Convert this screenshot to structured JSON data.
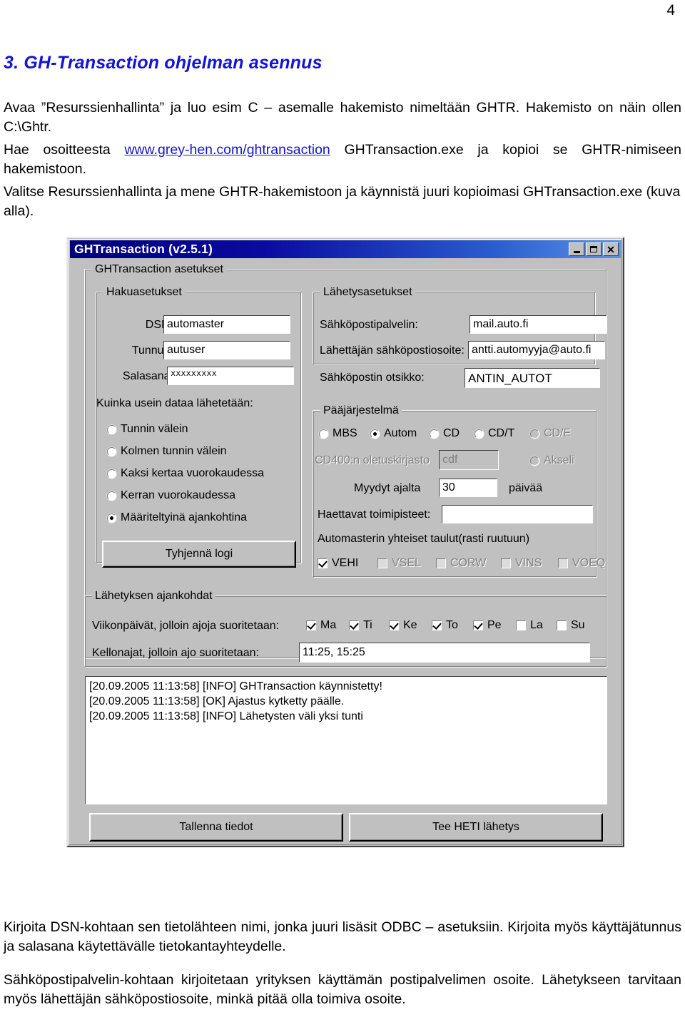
{
  "document": {
    "page_number": "4",
    "heading": "3. GH-Transaction ohjelman asennus",
    "para1_a": "Avaa ”Resurssienhallinta” ja luo esim C – asemalle hakemisto nimeltään GHTR. Hakemisto on näin ollen C:\\Ghtr.",
    "para2_pre": "Hae osoitteesta ",
    "para2_link": "www.grey-hen.com/ghtransaction",
    "para2_post": " GHTransaction.exe ja kopioi se GHTR-nimiseen hakemistoon.",
    "para3": "Valitse Resurssienhallinta ja mene GHTR-hakemistoon ja käynnistä juuri kopioimasi GHTransaction.exe (kuva alla).",
    "para4": "Kirjoita DSN-kohtaan sen tietolähteen nimi, jonka juuri lisäsit ODBC – asetuksiin. Kirjoita myös käyttäjätunnus ja salasana käytettävälle tietokantayhteydelle.",
    "para5": "Sähköpostipalvelin-kohtaan kirjoitetaan yrityksen käyttämän postipalvelimen osoite. Lähetykseen tarvitaan myös lähettäjän sähköpostiosoite, minkä pitää olla toimiva osoite.",
    "link_color": "#1414d2",
    "heading_color": "#1414d2"
  },
  "dialog": {
    "title": "GHTransaction (v2.5.1)",
    "titlebar_color": "#00007b",
    "face_color": "#c0c0c0",
    "titlebar_buttons": [
      {
        "name": "minimize-button",
        "glyph": "_"
      },
      {
        "name": "maximize-button",
        "glyph": "□"
      },
      {
        "name": "close-button",
        "glyph": "X"
      }
    ],
    "outer_group_label": "GHTransaction asetukset",
    "search_group": {
      "label": "Hakuasetukset",
      "dsn_label": "DSN:",
      "dsn_value": "automaster",
      "user_label": "Tunnus:",
      "user_value": "autuser",
      "password_label": "Salasana:",
      "password_value": "xxxxxxxxx"
    },
    "frequency": {
      "label": "Kuinka usein dataa lähetetään:",
      "options": [
        {
          "label": "Tunnin välein",
          "selected": false
        },
        {
          "label": "Kolmen tunnin välein",
          "selected": false
        },
        {
          "label": "Kaksi kertaa vuorokaudessa",
          "selected": false
        },
        {
          "label": "Kerran vuorokaudessa",
          "selected": false
        },
        {
          "label": "Määriteltyinä ajankohtina",
          "selected": true
        }
      ],
      "clear_log_button": "Tyhjennä logi"
    },
    "send_group": {
      "label": "Lähetysasetukset",
      "server_label": "Sähköpostipalvelin:",
      "server_value": "mail.auto.fi",
      "sender_label": "Lähettäjän sähköpostiosoite:",
      "sender_value": "antti.automyyja@auto.fi",
      "subject_label": "Sähköpostin otsikko:",
      "subject_value": "ANTIN_AUTOT"
    },
    "main_system": {
      "label": "Pääjärjestelmä",
      "options": [
        {
          "label": "MBS",
          "selected": false,
          "disabled": false
        },
        {
          "label": "Autom",
          "selected": true,
          "disabled": false
        },
        {
          "label": "CD",
          "selected": false,
          "disabled": false
        },
        {
          "label": "CD/T",
          "selected": false,
          "disabled": false
        },
        {
          "label": "CD/E",
          "selected": false,
          "disabled": true
        }
      ],
      "cd400_label": "CD400:n oletuskirjasto",
      "cd400_value": "cdf",
      "akseli_label": "Akseli",
      "akseli_selected": false,
      "sold_label": "Myydyt ajalta",
      "sold_value": "30",
      "sold_unit": "päivää",
      "offices_label": "Haettavat toimipisteet:",
      "offices_value": "",
      "tables_label": "Automasterin yhteiset taulut(rasti ruutuun)",
      "tables": [
        {
          "label": "VEHI",
          "checked": true,
          "disabled": false
        },
        {
          "label": "VSEL",
          "checked": false,
          "disabled": true
        },
        {
          "label": "CORW",
          "checked": false,
          "disabled": true
        },
        {
          "label": "VINS",
          "checked": false,
          "disabled": true
        },
        {
          "label": "VOEQ",
          "checked": false,
          "disabled": true
        }
      ]
    },
    "schedule": {
      "label": "Lähetyksen ajankohdat",
      "weekdays_label": "Viikonpäivät, jolloin ajoja suoritetaan:",
      "days": [
        {
          "label": "Ma",
          "checked": true
        },
        {
          "label": "Ti",
          "checked": true
        },
        {
          "label": "Ke",
          "checked": true
        },
        {
          "label": "To",
          "checked": true
        },
        {
          "label": "Pe",
          "checked": true
        },
        {
          "label": "La",
          "checked": false
        },
        {
          "label": "Su",
          "checked": false
        }
      ],
      "times_label": "Kellonajat, jolloin ajo suoritetaan:",
      "times_value": "11:25, 15:25"
    },
    "log_lines": [
      "[20.09.2005 11:13:58] [INFO] GHTransaction käynnistetty!",
      "[20.09.2005 11:13:58] [OK] Ajastus kytketty päälle.",
      "[20.09.2005 11:13:58] [INFO] Lähetysten väli yksi tunti"
    ],
    "save_button": "Tallenna tiedot",
    "send_now_button": "Tee HETI lähetys"
  }
}
